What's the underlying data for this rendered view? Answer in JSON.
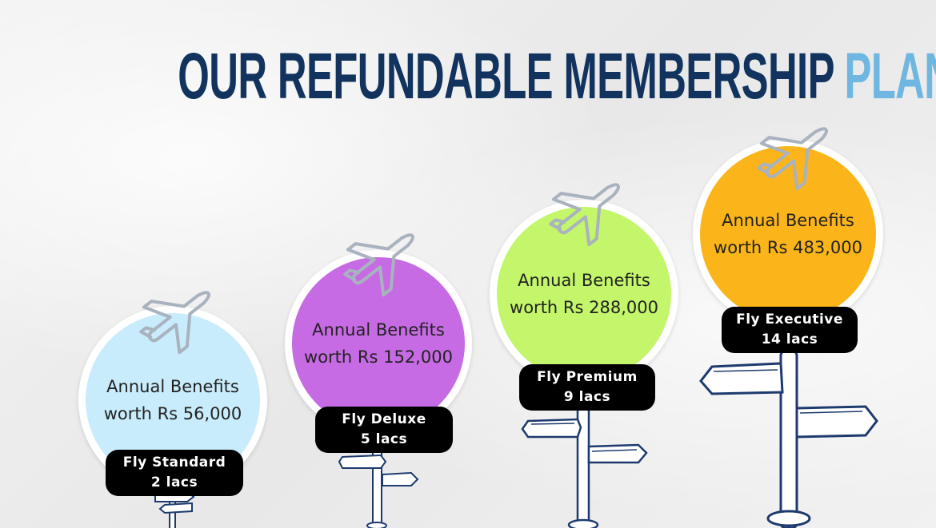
{
  "title": {
    "main": "OUR REFUNDABLE MEMBERSHIP",
    "accent": "PLANS"
  },
  "colors": {
    "title_dark": "#11335e",
    "title_accent": "#6fb7e0",
    "standard": "#c8ecfb",
    "deluxe": "#c66be3",
    "premium": "#c3f66a",
    "executive": "#fbb51a"
  },
  "plans": [
    {
      "line1": "Annual Benefits",
      "line2": "worth Rs 56,000",
      "name": "Fly Standard",
      "price": "2 lacs",
      "icon": "airplane-icon"
    },
    {
      "line1": "Annual Benefits",
      "line2": "worth Rs 152,000",
      "name": "Fly Deluxe",
      "price": "5 lacs",
      "icon": "airplane-icon"
    },
    {
      "line1": "Annual Benefits",
      "line2": "worth Rs 288,000",
      "name": "Fly Premium",
      "price": "9 lacs",
      "icon": "airplane-icon"
    },
    {
      "line1": "Annual Benefits",
      "line2": "worth Rs 483,000",
      "name": "Fly Executive",
      "price": "14 lacs",
      "icon": "airplane-icon"
    }
  ]
}
